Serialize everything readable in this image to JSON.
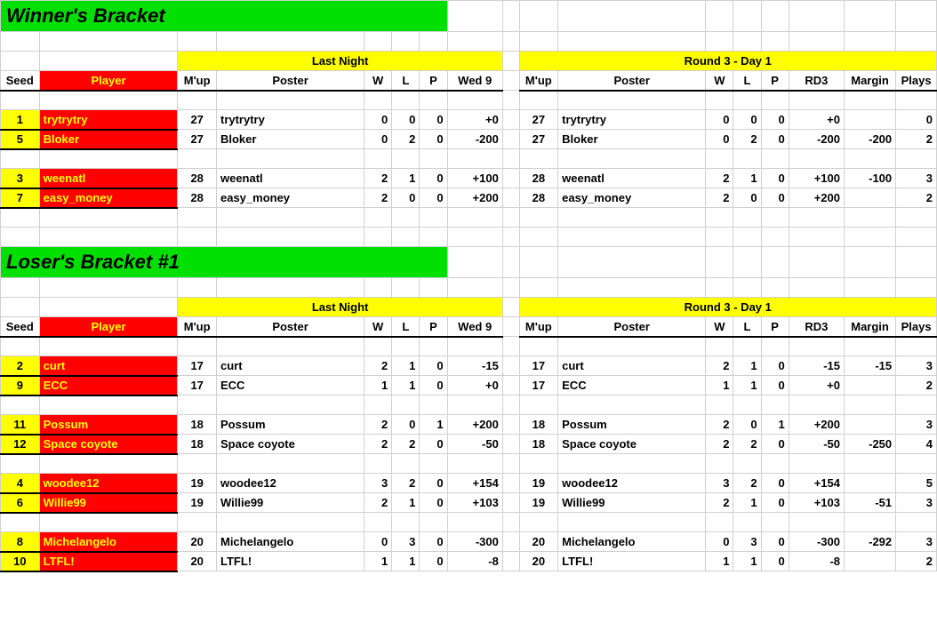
{
  "labels": {
    "seed": "Seed",
    "player": "Player",
    "mup": "M'up",
    "poster": "Poster",
    "w": "W",
    "l": "L",
    "p": "P",
    "margin": "Margin",
    "plays": "Plays"
  },
  "brackets": [
    {
      "title": "Winner's Bracket",
      "section1": "Last Night",
      "section2": "Round 3 - Day 1",
      "day_col": "Wed 9",
      "rd_col": "RD3",
      "groups": [
        [
          {
            "seed": "1",
            "player": "trytrytry",
            "ln": {
              "mup": "27",
              "poster": "trytrytry",
              "w": "0",
              "l": "0",
              "p": "0",
              "score": "+0"
            },
            "rd": {
              "mup": "27",
              "poster": "trytrytry",
              "w": "0",
              "l": "0",
              "p": "0",
              "score": "+0",
              "margin": "",
              "plays": "0"
            }
          },
          {
            "seed": "5",
            "player": "Bloker",
            "ln": {
              "mup": "27",
              "poster": "Bloker",
              "w": "0",
              "l": "2",
              "p": "0",
              "score": "-200"
            },
            "rd": {
              "mup": "27",
              "poster": "Bloker",
              "w": "0",
              "l": "2",
              "p": "0",
              "score": "-200",
              "margin": "-200",
              "plays": "2"
            }
          }
        ],
        [
          {
            "seed": "3",
            "player": "weenatl",
            "ln": {
              "mup": "28",
              "poster": "weenatl",
              "w": "2",
              "l": "1",
              "p": "0",
              "score": "+100"
            },
            "rd": {
              "mup": "28",
              "poster": "weenatl",
              "w": "2",
              "l": "1",
              "p": "0",
              "score": "+100",
              "margin": "-100",
              "plays": "3"
            }
          },
          {
            "seed": "7",
            "player": "easy_money",
            "ln": {
              "mup": "28",
              "poster": "easy_money",
              "w": "2",
              "l": "0",
              "p": "0",
              "score": "+200"
            },
            "rd": {
              "mup": "28",
              "poster": "easy_money",
              "w": "2",
              "l": "0",
              "p": "0",
              "score": "+200",
              "margin": "",
              "plays": "2"
            }
          }
        ]
      ]
    },
    {
      "title": "Loser's Bracket #1",
      "section1": "Last Night",
      "section2": "Round 3 - Day 1",
      "day_col": "Wed 9",
      "rd_col": "RD3",
      "groups": [
        [
          {
            "seed": "2",
            "player": "curt",
            "ln": {
              "mup": "17",
              "poster": "curt",
              "w": "2",
              "l": "1",
              "p": "0",
              "score": "-15"
            },
            "rd": {
              "mup": "17",
              "poster": "curt",
              "w": "2",
              "l": "1",
              "p": "0",
              "score": "-15",
              "margin": "-15",
              "plays": "3"
            }
          },
          {
            "seed": "9",
            "player": "ECC",
            "ln": {
              "mup": "17",
              "poster": "ECC",
              "w": "1",
              "l": "1",
              "p": "0",
              "score": "+0"
            },
            "rd": {
              "mup": "17",
              "poster": "ECC",
              "w": "1",
              "l": "1",
              "p": "0",
              "score": "+0",
              "margin": "",
              "plays": "2"
            }
          }
        ],
        [
          {
            "seed": "11",
            "player": "Possum",
            "ln": {
              "mup": "18",
              "poster": "Possum",
              "w": "2",
              "l": "0",
              "p": "1",
              "score": "+200"
            },
            "rd": {
              "mup": "18",
              "poster": "Possum",
              "w": "2",
              "l": "0",
              "p": "1",
              "score": "+200",
              "margin": "",
              "plays": "3"
            }
          },
          {
            "seed": "12",
            "player": "Space coyote",
            "ln": {
              "mup": "18",
              "poster": "Space coyote",
              "w": "2",
              "l": "2",
              "p": "0",
              "score": "-50"
            },
            "rd": {
              "mup": "18",
              "poster": "Space coyote",
              "w": "2",
              "l": "2",
              "p": "0",
              "score": "-50",
              "margin": "-250",
              "plays": "4"
            }
          }
        ],
        [
          {
            "seed": "4",
            "player": "woodee12",
            "ln": {
              "mup": "19",
              "poster": "woodee12",
              "w": "3",
              "l": "2",
              "p": "0",
              "score": "+154"
            },
            "rd": {
              "mup": "19",
              "poster": "woodee12",
              "w": "3",
              "l": "2",
              "p": "0",
              "score": "+154",
              "margin": "",
              "plays": "5"
            }
          },
          {
            "seed": "6",
            "player": "Willie99",
            "ln": {
              "mup": "19",
              "poster": "Willie99",
              "w": "2",
              "l": "1",
              "p": "0",
              "score": "+103"
            },
            "rd": {
              "mup": "19",
              "poster": "Willie99",
              "w": "2",
              "l": "1",
              "p": "0",
              "score": "+103",
              "margin": "-51",
              "plays": "3"
            }
          }
        ],
        [
          {
            "seed": "8",
            "player": "Michelangelo",
            "ln": {
              "mup": "20",
              "poster": "Michelangelo",
              "w": "0",
              "l": "3",
              "p": "0",
              "score": "-300"
            },
            "rd": {
              "mup": "20",
              "poster": "Michelangelo",
              "w": "0",
              "l": "3",
              "p": "0",
              "score": "-300",
              "margin": "-292",
              "plays": "3"
            }
          },
          {
            "seed": "10",
            "player": "LTFL!",
            "ln": {
              "mup": "20",
              "poster": "LTFL!",
              "w": "1",
              "l": "1",
              "p": "0",
              "score": "-8"
            },
            "rd": {
              "mup": "20",
              "poster": "LTFL!",
              "w": "1",
              "l": "1",
              "p": "0",
              "score": "-8",
              "margin": "",
              "plays": "2"
            }
          }
        ]
      ]
    }
  ]
}
